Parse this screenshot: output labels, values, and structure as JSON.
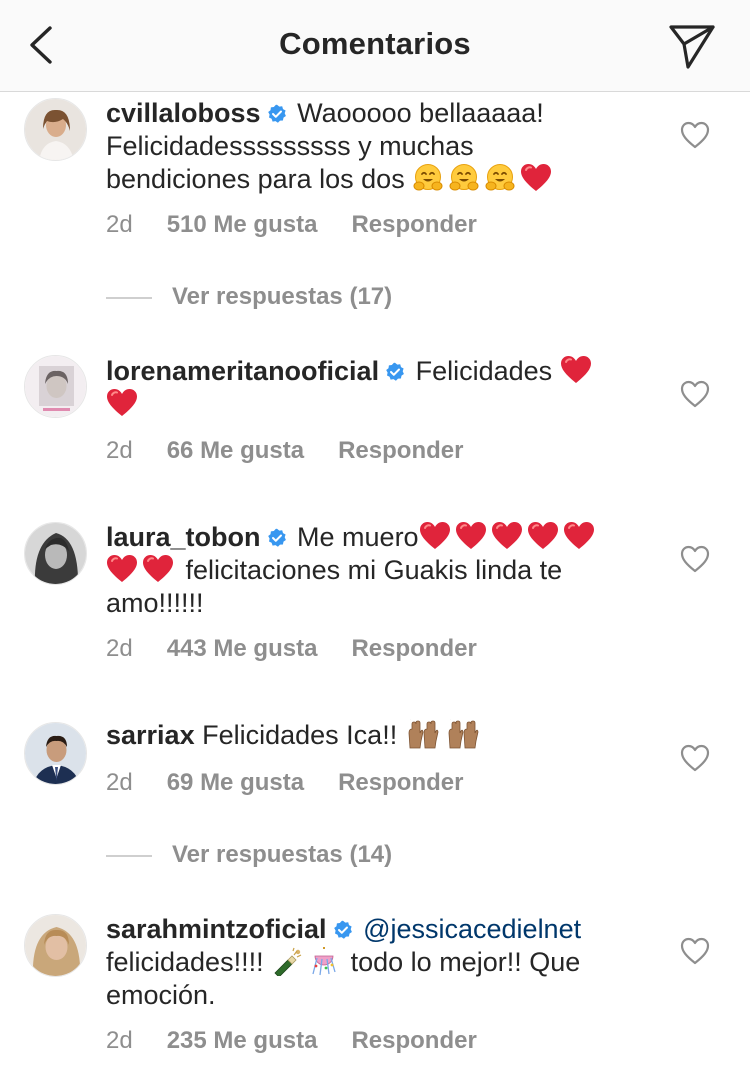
{
  "header": {
    "title": "Comentarios",
    "back_icon": "chevron-left-icon",
    "send_icon": "paper-plane-icon"
  },
  "colors": {
    "heart": "#e0243b",
    "verified": "#3897f0",
    "secondary": "#8e8e8e",
    "mention": "#00376b"
  },
  "comments": [
    {
      "username": "cvillaloboss",
      "verified": true,
      "lines": [
        "Waooooo bellaaaaa!",
        "Felicidadesssssssss y muchas",
        "bendiciones para los dos"
      ],
      "emojis": [
        "hugging-face",
        "hugging-face",
        "hugging-face",
        "red-heart"
      ],
      "time": "2d",
      "likes": "510 Me gusta",
      "reply": "Responder",
      "view_replies": "Ver respuestas (17)"
    },
    {
      "username": "lorenameritanooficial",
      "verified": true,
      "lines": [
        "Felicidades"
      ],
      "emojis": [
        "red-heart",
        "red-heart"
      ],
      "time": "2d",
      "likes": "66 Me gusta",
      "reply": "Responder"
    },
    {
      "username": "laura_tobon",
      "verified": true,
      "lines": [
        "Me muero",
        "felicitaciones mi Guakis linda te",
        "amo!!!!!!"
      ],
      "emojis": [
        "red-heart",
        "red-heart",
        "red-heart",
        "red-heart",
        "red-heart",
        "red-heart",
        "red-heart"
      ],
      "time": "2d",
      "likes": "443 Me gusta",
      "reply": "Responder"
    },
    {
      "username": "sarriax",
      "verified": false,
      "lines": [
        "Felicidades Ica!!"
      ],
      "emojis": [
        "raising-hands",
        "raising-hands"
      ],
      "time": "2d",
      "likes": "69 Me gusta",
      "reply": "Responder",
      "view_replies": "Ver respuestas (14)"
    },
    {
      "username": "sarahmintzoficial",
      "verified": true,
      "mention": "@jessicacedielnet",
      "lines": [
        "felicidades!!!!",
        "todo lo mejor!! Que",
        "emoción."
      ],
      "emojis": [
        "bottle-with-popping-cork",
        "confetti-ball"
      ],
      "time": "2d",
      "likes": "235 Me gusta",
      "reply": "Responder"
    }
  ]
}
